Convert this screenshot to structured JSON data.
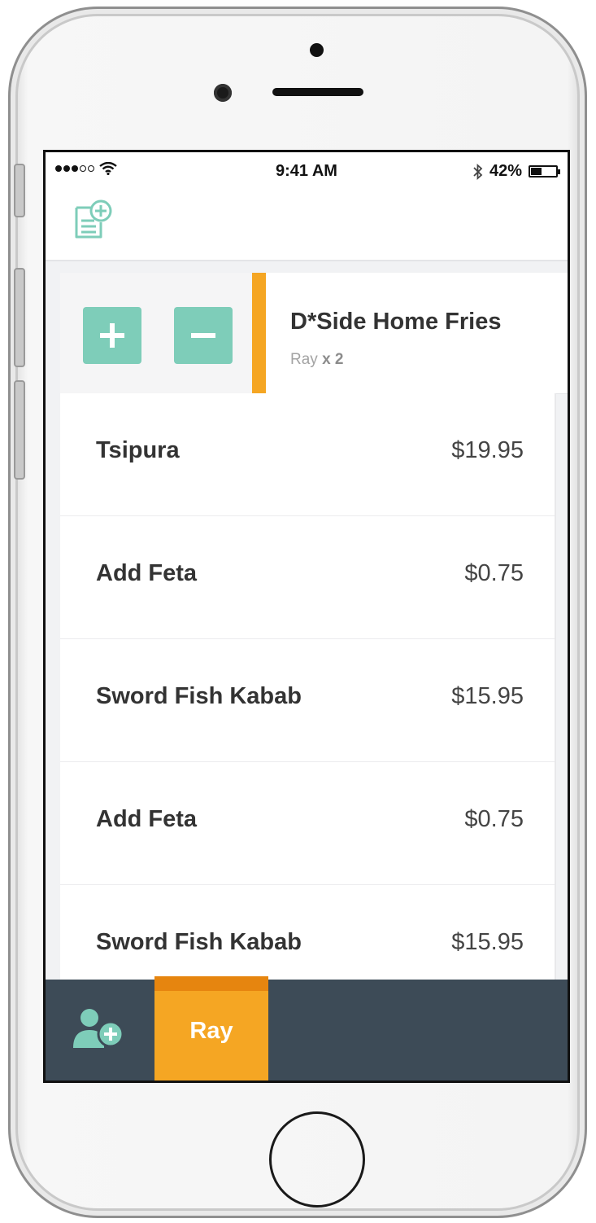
{
  "status_bar": {
    "time": "9:41 AM",
    "battery": "42%",
    "battery_level": 0.42
  },
  "toolbar": {
    "add_order_icon": "document-plus-icon"
  },
  "swiped_item": {
    "name": "D*Side Home Fries",
    "person": "Ray",
    "qty_label": "x 2",
    "plus_icon": "plus-icon",
    "minus_icon": "minus-icon"
  },
  "items": [
    {
      "name": "Tsipura",
      "price": "$19.95"
    },
    {
      "name": "Add Feta",
      "price": "$0.75"
    },
    {
      "name": "Sword Fish Kabab",
      "price": "$15.95"
    },
    {
      "name": "Add Feta",
      "price": "$0.75"
    },
    {
      "name": "Sword Fish Kabab",
      "price": "$15.95"
    }
  ],
  "bottom_bar": {
    "add_person_icon": "add-person-icon",
    "active_person": "Ray"
  },
  "colors": {
    "accent_green": "#7ecdb9",
    "accent_orange": "#f5a623",
    "bar_dark": "#3d4b57"
  }
}
